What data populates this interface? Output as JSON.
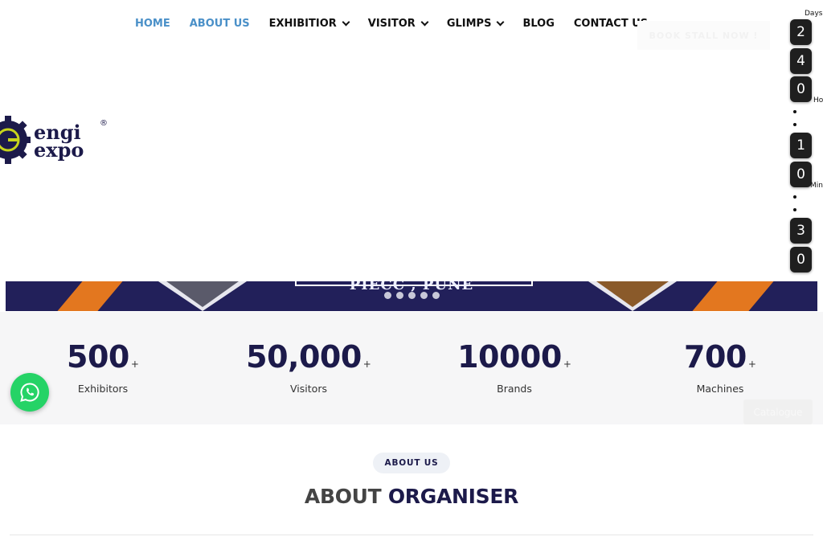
{
  "nav": {
    "items": [
      {
        "label": "HOME",
        "active": true,
        "dropdown": false
      },
      {
        "label": "ABOUT US",
        "active": true,
        "dropdown": false
      },
      {
        "label": "EXHIBITIOR",
        "active": false,
        "dropdown": true
      },
      {
        "label": "VISITOR",
        "active": false,
        "dropdown": true
      },
      {
        "label": "GLIMPS",
        "active": false,
        "dropdown": true
      },
      {
        "label": "BLOG",
        "active": false,
        "dropdown": false
      },
      {
        "label": "CONTACT US",
        "active": false,
        "dropdown": false
      }
    ],
    "book_button": "BOOK STALL NOW !"
  },
  "logo": {
    "line1": "engi",
    "line2": "expo",
    "mark": "®"
  },
  "countdown": {
    "labels": {
      "days": "Days",
      "hours": "Ho",
      "minutes": "Min"
    },
    "days": [
      "2",
      "4",
      "0"
    ],
    "hours": [
      "1",
      "0"
    ],
    "minutes": [
      "3",
      "0"
    ]
  },
  "banner": {
    "venue": "PIECC , PUNE",
    "slides": 5
  },
  "stats": [
    {
      "value": "500",
      "suffix": "+",
      "label": "Exhibitors"
    },
    {
      "value": "50,000",
      "suffix": "+",
      "label": "Visitors"
    },
    {
      "value": "10000",
      "suffix": "+",
      "label": "Brands"
    },
    {
      "value": "700",
      "suffix": "+",
      "label": "Machines"
    }
  ],
  "catalogue_button": "Catalogue",
  "about": {
    "pill": "ABOUT US",
    "title_part1": "ABOUT ",
    "title_part2": "ORGANISER"
  },
  "colors": {
    "brand_navy": "#1c1a4a",
    "accent_blue": "#4a90c8",
    "orange": "#e3771f",
    "whatsapp": "#25d366"
  },
  "icons": {
    "whatsapp": "whatsapp-icon",
    "dropdown": "chevron-down-icon",
    "logo": "gear-logo-icon"
  }
}
